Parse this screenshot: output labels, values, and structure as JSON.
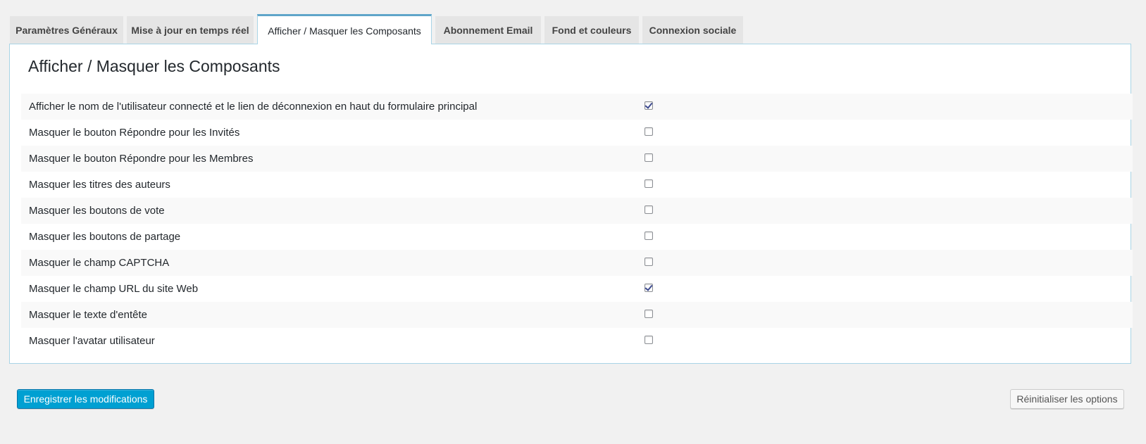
{
  "tabs": [
    {
      "label": "Paramètres Généraux",
      "active": false
    },
    {
      "label": "Mise à jour en temps réel",
      "active": false
    },
    {
      "label": "Afficher / Masquer les Composants",
      "active": true
    },
    {
      "label": "Abonnement Email",
      "active": false
    },
    {
      "label": "Fond et couleurs",
      "active": false
    },
    {
      "label": "Connexion sociale",
      "active": false
    }
  ],
  "panel": {
    "title": "Afficher / Masquer les Composants"
  },
  "options": [
    {
      "label": "Afficher le nom de l'utilisateur connecté et le lien de déconnexion en haut du formulaire principal",
      "checked": true
    },
    {
      "label": "Masquer le bouton Répondre pour les Invités",
      "checked": false
    },
    {
      "label": "Masquer le bouton Répondre pour les Membres",
      "checked": false
    },
    {
      "label": "Masquer les titres des auteurs",
      "checked": false
    },
    {
      "label": "Masquer les boutons de vote",
      "checked": false
    },
    {
      "label": "Masquer les boutons de partage",
      "checked": false
    },
    {
      "label": "Masquer le champ CAPTCHA",
      "checked": false
    },
    {
      "label": "Masquer le champ URL du site Web",
      "checked": true
    },
    {
      "label": "Masquer le texte d'entête",
      "checked": false
    },
    {
      "label": "Masquer l'avatar utilisateur",
      "checked": false
    }
  ],
  "actions": {
    "save_label": "Enregistrer les modifications",
    "reset_label": "Réinitialiser les options"
  },
  "colors": {
    "page_background": "#f1f1f1",
    "tab_inactive": "#e5e5e5",
    "tab_active_border": "#5fa5c9",
    "primary_button": "#00a0d2",
    "checkmark": "#3d4a8f"
  }
}
